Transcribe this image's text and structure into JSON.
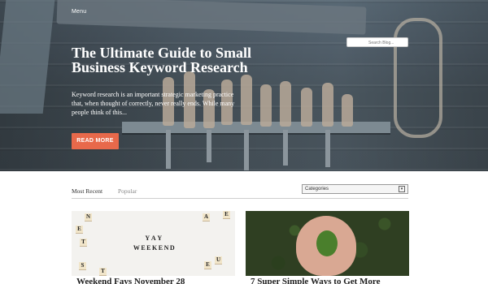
{
  "header": {
    "menu_label": "Menu",
    "search_placeholder": "Search Blog..."
  },
  "hero": {
    "title": "The Ultimate Guide to Small Business Keyword Research",
    "excerpt": "Keyword research is an important strategic marketing practice that, when thought of correctly, never really ends. While many people think of this...",
    "button_label": "READ MORE",
    "accent_color": "#e8694b"
  },
  "filters": {
    "tabs": [
      {
        "label": "Most Recent",
        "active": true
      },
      {
        "label": "Popular",
        "active": false
      }
    ],
    "categories_label": "Categories",
    "categories_icon": "dropdown-arrow-icon"
  },
  "posts": [
    {
      "title": "Weekend Favs November 28",
      "image_tiles_line1": "YAY",
      "image_tiles_line2": "WEEKEND"
    },
    {
      "title": "7 Super Simple Ways to Get More"
    }
  ]
}
